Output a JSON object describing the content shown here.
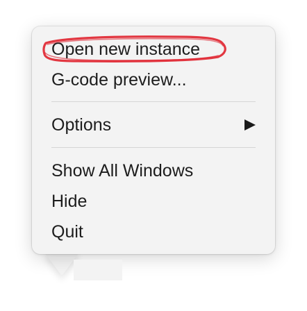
{
  "menu": {
    "items": [
      {
        "label": "Open new instance",
        "highlighted": true,
        "highlight_color": "#e0222e"
      },
      {
        "label": "G-code preview..."
      },
      {
        "label": "Options",
        "has_submenu": true,
        "submenu_icon": "triangle-right-icon"
      },
      {
        "label": "Show All Windows"
      },
      {
        "label": "Hide"
      },
      {
        "label": "Quit"
      }
    ]
  },
  "colors": {
    "menu_background": "#f3f3f3",
    "text": "#1d1d1d",
    "separator": "#d5d5d5",
    "annotation": "#e0222e"
  }
}
